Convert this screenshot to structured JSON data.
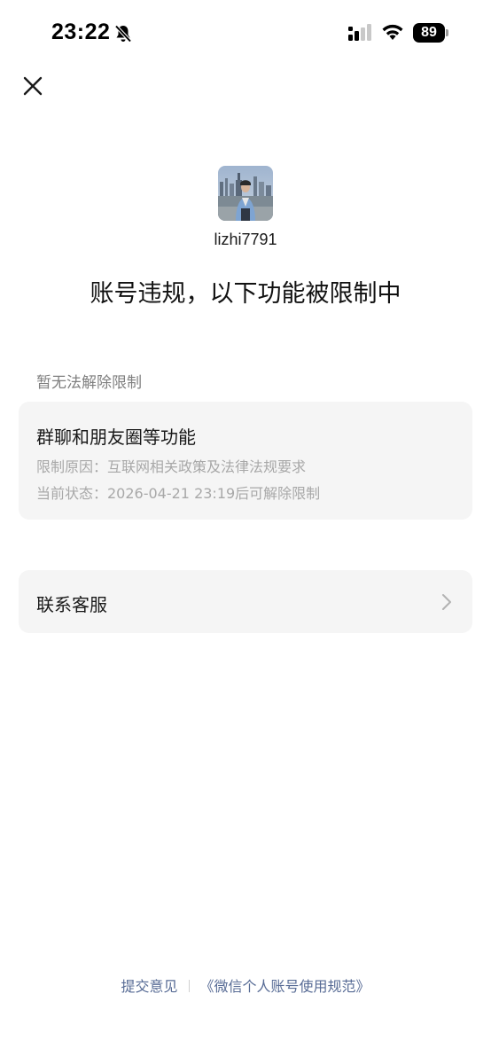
{
  "status_bar": {
    "time": "23:22",
    "battery_level": "89",
    "icons": [
      "bell-off-icon",
      "signal-icon",
      "wifi-icon",
      "battery-icon"
    ]
  },
  "header": {
    "close_icon": "close-icon"
  },
  "profile": {
    "username": "lizhi7791",
    "avatar": "user-photo"
  },
  "title": "账号违规，以下功能被限制中",
  "section_label": "暂无法解除限制",
  "restriction": {
    "title": "群聊和朋友圈等功能",
    "reason": "限制原因：互联网相关政策及法律法规要求",
    "status": "当前状态：2026-04-21 23:19后可解除限制"
  },
  "contact_service": {
    "label": "联系客服",
    "icon": "chevron-right-icon"
  },
  "footer": {
    "feedback_link": "提交意见",
    "policy_link": "《微信个人账号使用规范》"
  },
  "colors": {
    "background": "#ffffff",
    "card_background": "#f5f5f5",
    "secondary_text": "#a8a8a8",
    "link": "#576b95"
  }
}
